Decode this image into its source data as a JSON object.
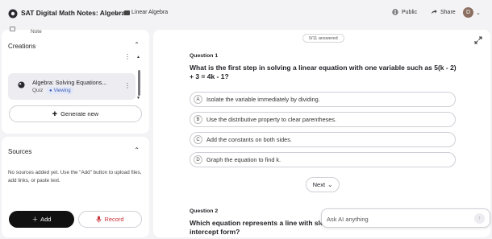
{
  "header": {
    "notebook_title": "SAT Digital Math Notes: Algebra",
    "folder_label": "Linear Algebra",
    "public_label": "Public",
    "share_label": "Share",
    "avatar_initial": "D"
  },
  "creations": {
    "title": "Creations",
    "items": [
      {
        "type": "Note"
      },
      {
        "title": "Algebra: Solving Equations...",
        "type": "Quiz",
        "badge": "Viewing"
      }
    ],
    "generate_label": "Generate new"
  },
  "sources": {
    "title": "Sources",
    "empty_text": "No sources added yet. Use the \"Add\" button to upload files, add links, or paste text.",
    "add_label": "Add",
    "record_label": "Record"
  },
  "quiz": {
    "progress": "0/11 answered",
    "questions": [
      {
        "label": "Question 1",
        "text": "What is the first step in solving a linear equation with one variable such as 5(k - 2) + 3 = 4k - 1?",
        "options": [
          {
            "letter": "A",
            "text": "Isolate the variable immediately by dividing."
          },
          {
            "letter": "B",
            "text": "Use the distributive property to clear parentheses."
          },
          {
            "letter": "C",
            "text": "Add the constants on both sides."
          },
          {
            "letter": "D",
            "text": "Graph the equation to find k."
          }
        ]
      },
      {
        "label": "Question 2",
        "text": "Which equation represents a line with slo"
      }
    ],
    "question2_text_tail": "intercept form?",
    "next_label": "Next"
  },
  "ask_ai": {
    "placeholder": "Ask AI anything"
  },
  "colors": {
    "accent": "#3d5ab3",
    "record": "#c9333a",
    "primary_button": "#111111"
  }
}
